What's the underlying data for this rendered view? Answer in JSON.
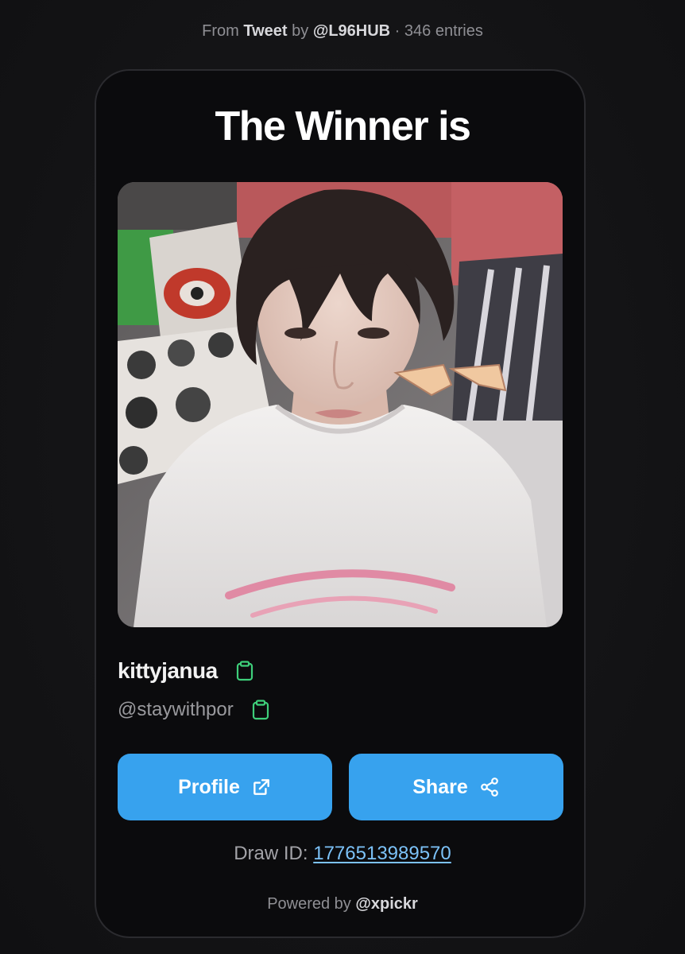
{
  "header": {
    "prefix": "From",
    "source": "Tweet",
    "by": "by",
    "author": "@L96HUB",
    "separator": "·",
    "entries": "346 entries"
  },
  "card": {
    "title": "The Winner is",
    "winner": {
      "display_name": "kittyjanua",
      "handle": "@staywithpor",
      "copy_icon": "clipboard-icon"
    },
    "buttons": {
      "profile_label": "Profile",
      "profile_icon": "external-link-icon",
      "share_label": "Share",
      "share_icon": "share-icon"
    },
    "draw_id": {
      "label": "Draw ID:",
      "value": "1776513989570"
    },
    "footer": {
      "prefix": "Powered by",
      "brand": "@xpickr"
    }
  },
  "colors": {
    "background": "#141416",
    "card_background": "#0b0b0d",
    "button": "#37a2ee",
    "link": "#7cc2f8",
    "copy_icon": "#3ecf7a"
  }
}
